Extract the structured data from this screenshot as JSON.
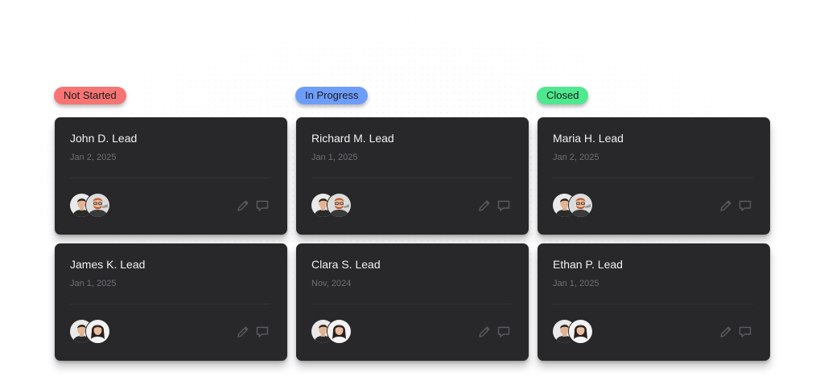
{
  "columns": [
    {
      "status": "Not Started",
      "color": "#f77474",
      "cards": [
        {
          "name": "John D. Lead",
          "date": "Jan 2, 2025",
          "avatars": [
            "man-dark-hair",
            "man-red-beard-glasses"
          ]
        },
        {
          "name": "James K. Lead",
          "date": "Jan 1, 2025",
          "avatars": [
            "man-dark-hair",
            "woman-dark-hair"
          ]
        }
      ]
    },
    {
      "status": "In Progress",
      "color": "#6e9df9",
      "cards": [
        {
          "name": "Richard M. Lead",
          "date": "Jan 1, 2025",
          "avatars": [
            "man-dark-hair",
            "man-red-beard-glasses"
          ]
        },
        {
          "name": "Clara S. Lead",
          "date": "Nov, 2024",
          "avatars": [
            "man-dark-hair",
            "woman-dark-hair"
          ]
        }
      ]
    },
    {
      "status": "Closed",
      "color": "#4ee98f",
      "cards": [
        {
          "name": "Maria H. Lead",
          "date": "Jan 2, 2025",
          "avatars": [
            "man-dark-hair",
            "man-red-beard-glasses"
          ]
        },
        {
          "name": "Ethan P. Lead",
          "date": "Jan 1, 2025",
          "avatars": [
            "man-dark-hair",
            "woman-dark-hair"
          ]
        }
      ]
    }
  ],
  "icons": {
    "edit": "pencil-icon",
    "comment": "comment-icon"
  }
}
